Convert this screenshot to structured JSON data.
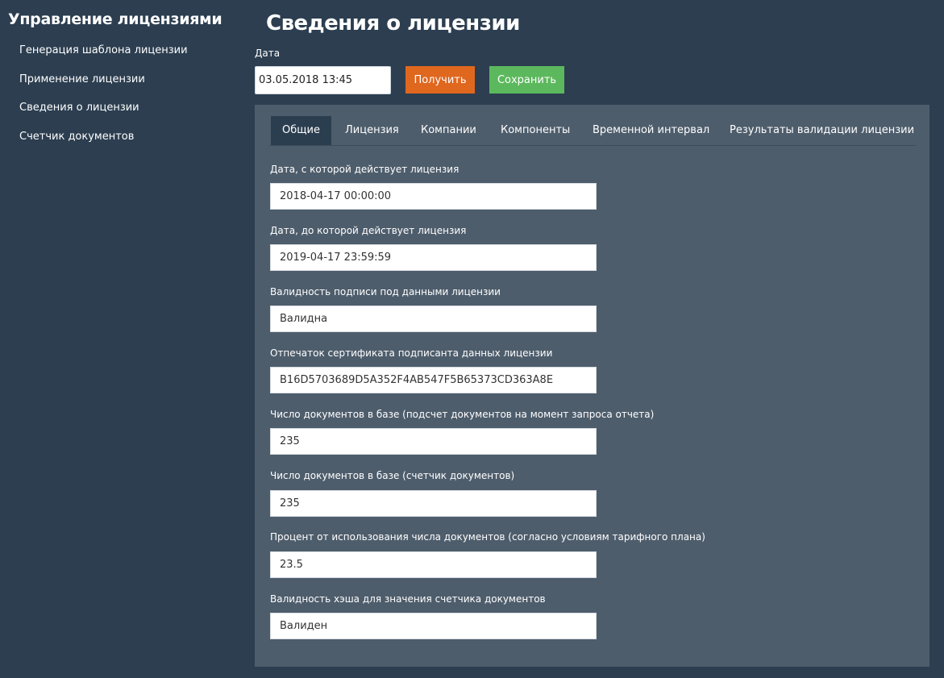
{
  "sidebar": {
    "title": "Управление лицензиями",
    "items": [
      {
        "label": "Генерация шаблона лицензии"
      },
      {
        "label": "Применение лицензии"
      },
      {
        "label": "Сведения о лицензии"
      },
      {
        "label": "Счетчик документов"
      }
    ]
  },
  "header": {
    "title": "Сведения о лицензии",
    "date_label": "Дата",
    "date_value": "03.05.2018 13:45",
    "get_button": "Получить",
    "save_button": "Сохранить"
  },
  "tabs": [
    {
      "label": "Общие",
      "active": true
    },
    {
      "label": "Лицензия"
    },
    {
      "label": "Компании"
    },
    {
      "label": "Компоненты"
    },
    {
      "label": "Временной интервал"
    },
    {
      "label": "Результаты валидации лицензии"
    }
  ],
  "fields": [
    {
      "label": "Дата, с которой действует лицензия",
      "value": "2018-04-17 00:00:00"
    },
    {
      "label": "Дата, до которой действует лицензия",
      "value": "2019-04-17 23:59:59"
    },
    {
      "label": "Валидность подписи под данными лицензии",
      "value": "Валидна"
    },
    {
      "label": "Отпечаток сертификата подписанта данных лицензии",
      "value": "B16D5703689D5A352F4AB547F5B65373CD363A8E"
    },
    {
      "label": "Число документов в базе (подсчет документов на момент запроса отчета)",
      "value": "235"
    },
    {
      "label": "Число документов в базе (счетчик документов)",
      "value": "235"
    },
    {
      "label": "Процент от использования числа документов (согласно условиям тарифного плана)",
      "value": "23.5"
    },
    {
      "label": "Валидность хэша для значения счетчика документов",
      "value": "Валиден"
    }
  ],
  "colors": {
    "background": "#2c3e50",
    "panel": "#4e5d6c",
    "get_button": "#e0671e",
    "save_button": "#5cb85c"
  }
}
